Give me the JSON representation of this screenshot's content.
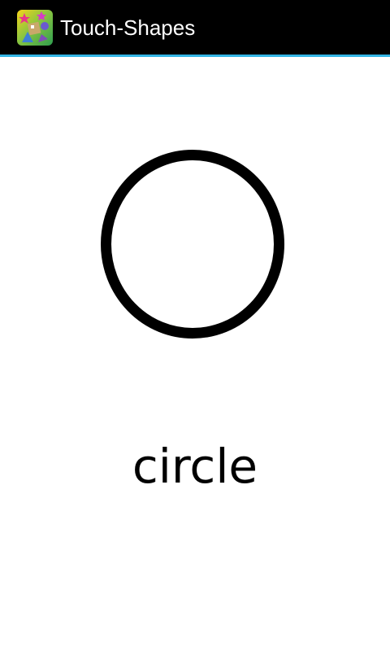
{
  "action_bar": {
    "title": "Touch-Shapes",
    "icon": "app-launcher-icon",
    "background_color": "#000000",
    "accent_color": "#33b5e5",
    "title_color": "#ffffff"
  },
  "main": {
    "shape": {
      "name": "circle",
      "icon": "circle-outline-icon",
      "stroke_color": "#000000"
    },
    "label": "circle"
  }
}
